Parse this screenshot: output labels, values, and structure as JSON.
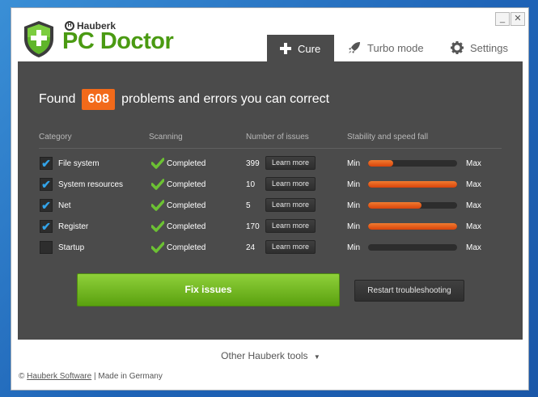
{
  "app": {
    "brand_small": "Hauberk",
    "brand_name": "PC Doctor",
    "minimize_label": "_",
    "close_label": "✕"
  },
  "tabs": [
    {
      "label": "Cure",
      "icon": "plus-icon",
      "active": true
    },
    {
      "label": "Turbo mode",
      "icon": "rocket-icon",
      "active": false
    },
    {
      "label": "Settings",
      "icon": "gear-icon",
      "active": false
    }
  ],
  "summary": {
    "prefix": "Found",
    "count": "608",
    "suffix": "problems and errors you can correct"
  },
  "table": {
    "headers": [
      "Category",
      "Scanning",
      "Number of issues",
      "Stability and speed fall"
    ],
    "rows": [
      {
        "checked": true,
        "category": "File system",
        "status": "Completed",
        "issues": "399",
        "learn": "Learn more",
        "min": "Min",
        "max": "Max",
        "level": 0.28
      },
      {
        "checked": true,
        "category": "System resources",
        "status": "Completed",
        "issues": "10",
        "learn": "Learn more",
        "min": "Min",
        "max": "Max",
        "level": 1.0
      },
      {
        "checked": true,
        "category": "Net",
        "status": "Completed",
        "issues": "5",
        "learn": "Learn more",
        "min": "Min",
        "max": "Max",
        "level": 0.6
      },
      {
        "checked": true,
        "category": "Register",
        "status": "Completed",
        "issues": "170",
        "learn": "Learn more",
        "min": "Min",
        "max": "Max",
        "level": 1.0
      },
      {
        "checked": false,
        "category": "Startup",
        "status": "Completed",
        "issues": "24",
        "learn": "Learn more",
        "min": "Min",
        "max": "Max",
        "level": 0.0
      }
    ]
  },
  "actions": {
    "fix_label": "Fix issues",
    "restart_label": "Restart troubleshooting"
  },
  "other_tools": "Other Hauberk tools",
  "footer": {
    "copyright": "©",
    "link": "Hauberk Software",
    "rest": "| Made in Germany"
  },
  "colors": {
    "accent_green": "#4a9a12",
    "accent_orange": "#f26a1a",
    "panel": "#4b4b4b",
    "check_blue": "#33a3e8"
  }
}
